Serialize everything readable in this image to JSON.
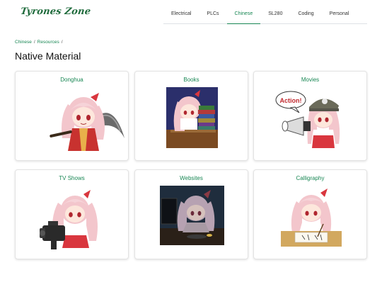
{
  "site": {
    "brand": "Tyrones Zone"
  },
  "nav": {
    "items": [
      {
        "label": "Electrical",
        "active": false
      },
      {
        "label": "PLCs",
        "active": false
      },
      {
        "label": "Chinese",
        "active": true
      },
      {
        "label": "SL280",
        "active": false
      },
      {
        "label": "Coding",
        "active": false
      },
      {
        "label": "Personal",
        "active": false
      }
    ]
  },
  "breadcrumb": {
    "items": [
      "Chinese",
      "Resources"
    ],
    "separator": "/"
  },
  "page": {
    "title": "Native Material"
  },
  "cards": [
    {
      "title": "Donghua",
      "image": "chibi-girl-with-sword"
    },
    {
      "title": "Books",
      "image": "chibi-girl-with-book-stack"
    },
    {
      "title": "Movies",
      "image": "chibi-girl-with-megaphone",
      "bubble_text": "Action!"
    },
    {
      "title": "TV Shows",
      "image": "chibi-girl-with-camera"
    },
    {
      "title": "Websites",
      "image": "chibi-girl-at-computer"
    },
    {
      "title": "Calligraphy",
      "image": "chibi-girl-writing"
    }
  ],
  "colors": {
    "accent": "#198754",
    "brand": "#1f6b3c",
    "hair": "#f3c6cc",
    "bow": "#d9363e"
  }
}
